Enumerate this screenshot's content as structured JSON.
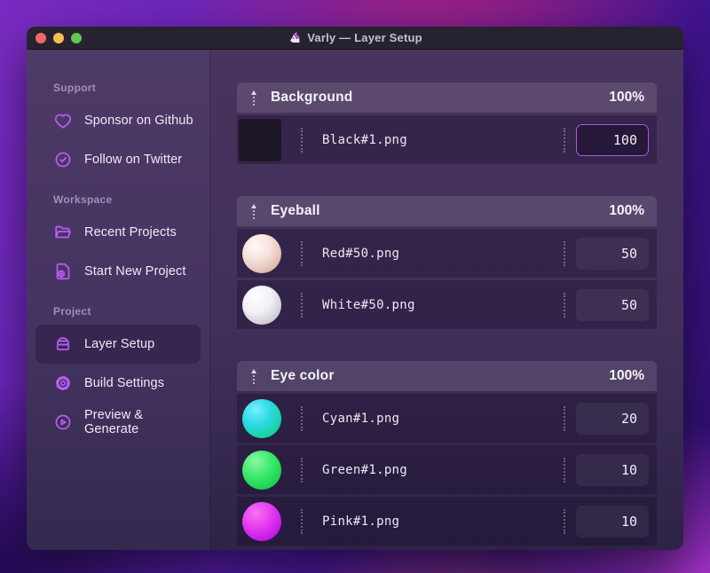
{
  "window": {
    "title": "Varly — Layer Setup",
    "app_icon": "unicorn-icon",
    "traffic_lights": [
      "close",
      "minimize",
      "zoom"
    ]
  },
  "sidebar": {
    "sections": [
      {
        "label": "Support",
        "items": [
          {
            "icon": "heart-icon",
            "label": "Sponsor on Github",
            "active": false
          },
          {
            "icon": "badge-check-icon",
            "label": "Follow on Twitter",
            "active": false
          }
        ]
      },
      {
        "label": "Workspace",
        "items": [
          {
            "icon": "folder-open-icon",
            "label": "Recent Projects",
            "active": false
          },
          {
            "icon": "file-plus-icon",
            "label": "Start New Project",
            "active": false
          }
        ]
      },
      {
        "label": "Project",
        "items": [
          {
            "icon": "layers-icon",
            "label": "Layer Setup",
            "active": true
          },
          {
            "icon": "gear-icon",
            "label": "Build Settings",
            "active": false
          },
          {
            "icon": "play-circle-icon",
            "label": "Preview & Generate",
            "active": false
          }
        ]
      }
    ]
  },
  "main": {
    "groups": [
      {
        "name": "Background",
        "weight": "100%",
        "layers": [
          {
            "file": "Black#1.png",
            "value": "100",
            "thumb": "black-square",
            "focused": true
          }
        ]
      },
      {
        "name": "Eyeball",
        "weight": "100%",
        "layers": [
          {
            "file": "Red#50.png",
            "value": "50",
            "thumb": "pearl-red",
            "focused": false
          },
          {
            "file": "White#50.png",
            "value": "50",
            "thumb": "pearl-white",
            "focused": false
          }
        ]
      },
      {
        "name": "Eye color",
        "weight": "100%",
        "layers": [
          {
            "file": "Cyan#1.png",
            "value": "20",
            "thumb": "sphere-cyan",
            "focused": false
          },
          {
            "file": "Green#1.png",
            "value": "10",
            "thumb": "sphere-green",
            "focused": false
          },
          {
            "file": "Pink#1.png",
            "value": "10",
            "thumb": "sphere-pink",
            "focused": false
          }
        ]
      }
    ]
  },
  "colors": {
    "accent": "#a958e8",
    "sidebar_icon": "#bb5cf5",
    "titlebar_bg": "#27222f",
    "window_bg_top": "#48345d",
    "window_bg_bottom": "#2e2347",
    "row_bg": "rgba(14,4,30,0.28)",
    "traffic_red": "#ee6a5f",
    "traffic_yellow": "#f5bf4f",
    "traffic_green": "#61c554"
  }
}
